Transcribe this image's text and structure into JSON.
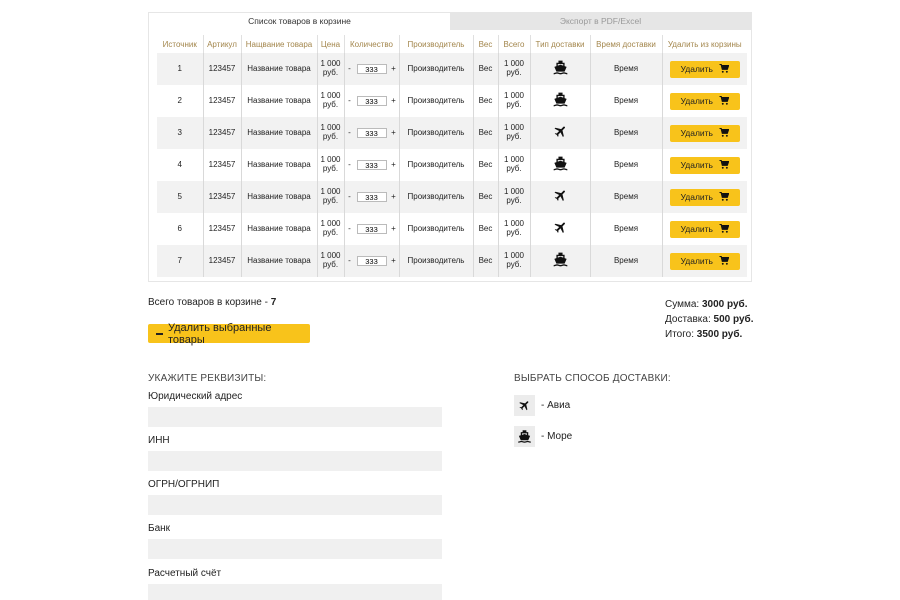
{
  "tabs": [
    {
      "label": "Список товаров в корзине",
      "active": true
    },
    {
      "label": "Экспорт в PDF/Excel",
      "active": false
    }
  ],
  "table": {
    "headers": [
      "Источник",
      "Артикул",
      "Нащвание товара",
      "Цена",
      "Количество",
      "Производитель",
      "Вес",
      "Всего",
      "Тип доставки",
      "Время доставки",
      "Удалить из корзины"
    ],
    "rows": [
      {
        "source": "1",
        "sku": "123457",
        "name": "Название товара",
        "price": "1 000 руб.",
        "qty": "333",
        "maker": "Производитель",
        "weight": "Вес",
        "total": "1 000 руб.",
        "delivery_icon": "ship-icon",
        "time": "Время",
        "delete_label": "Удалить"
      },
      {
        "source": "2",
        "sku": "123457",
        "name": "Название товара",
        "price": "1 000 руб.",
        "qty": "333",
        "maker": "Производитель",
        "weight": "Вес",
        "total": "1 000 руб.",
        "delivery_icon": "ship-icon",
        "time": "Время",
        "delete_label": "Удалить"
      },
      {
        "source": "3",
        "sku": "123457",
        "name": "Название товара",
        "price": "1 000 руб.",
        "qty": "333",
        "maker": "Производитель",
        "weight": "Вес",
        "total": "1 000 руб.",
        "delivery_icon": "plane-icon",
        "time": "Время",
        "delete_label": "Удалить"
      },
      {
        "source": "4",
        "sku": "123457",
        "name": "Название товара",
        "price": "1 000 руб.",
        "qty": "333",
        "maker": "Производитель",
        "weight": "Вес",
        "total": "1 000 руб.",
        "delivery_icon": "ship-icon",
        "time": "Время",
        "delete_label": "Удалить"
      },
      {
        "source": "5",
        "sku": "123457",
        "name": "Название товара",
        "price": "1 000 руб.",
        "qty": "333",
        "maker": "Производитель",
        "weight": "Вес",
        "total": "1 000 руб.",
        "delivery_icon": "plane-icon",
        "time": "Время",
        "delete_label": "Удалить"
      },
      {
        "source": "6",
        "sku": "123457",
        "name": "Название товара",
        "price": "1 000 руб.",
        "qty": "333",
        "maker": "Производитель",
        "weight": "Вес",
        "total": "1 000 руб.",
        "delivery_icon": "plane-icon",
        "time": "Время",
        "delete_label": "Удалить"
      },
      {
        "source": "7",
        "sku": "123457",
        "name": "Название товара",
        "price": "1 000 руб.",
        "qty": "333",
        "maker": "Производитель",
        "weight": "Вес",
        "total": "1 000 руб.",
        "delivery_icon": "ship-icon",
        "time": "Время",
        "delete_label": "Удалить"
      }
    ],
    "qty_minus": "-",
    "qty_plus": "+"
  },
  "cart_total": {
    "label": "Всего  товаров в корзине - ",
    "count": "7"
  },
  "summary": {
    "sum_label": "Сумма: ",
    "sum_value": "3000 руб.",
    "delivery_label": "Доставка: ",
    "delivery_value": "500 руб.",
    "total_label": "Итого: ",
    "total_value": "3500 руб."
  },
  "delete_selected_label": "Удалить выбранные товары",
  "requisites": {
    "title": "УКАЖИТЕ РЕКВИЗИТЫ:",
    "fields": [
      "Юридический адрес",
      "ИНН",
      "ОГРН/ОГРНИП",
      "Банк",
      "Расчетный счёт"
    ]
  },
  "delivery": {
    "title": "ВЫБРАТЬ СПОСОБ ДОСТАВКИ:",
    "options": [
      {
        "icon": "plane-icon",
        "label": "- Авиа"
      },
      {
        "icon": "ship-icon",
        "label": "- Море"
      }
    ]
  },
  "colors": {
    "accent": "#f8c31b",
    "header_text": "#a3864c",
    "row_alt": "#f2f2f2"
  }
}
